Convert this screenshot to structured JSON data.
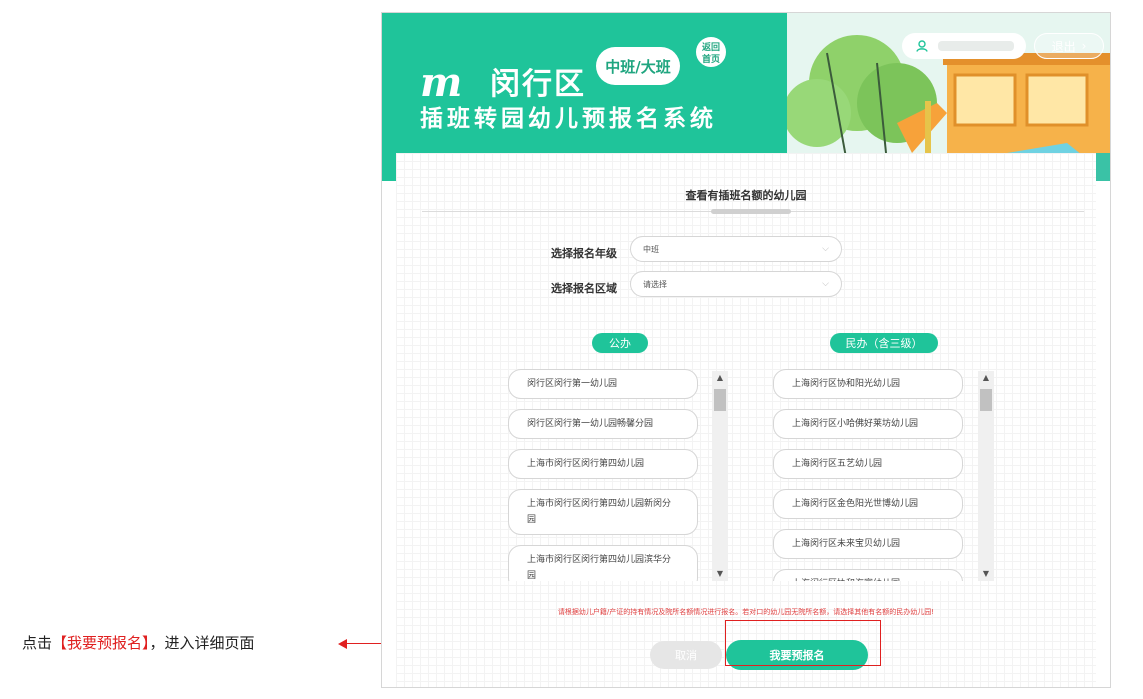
{
  "annotation": {
    "prefix": "点击",
    "highlight": "【我要预报名】",
    "suffix": "，进入详细页面"
  },
  "header": {
    "logo_mark": "m",
    "district": "闵行区",
    "badge": "中班/大班",
    "home_badge_line1": "返回",
    "home_badge_line2": "首页",
    "subtitle": "插班转园幼儿预报名系统",
    "logout_label": "退出"
  },
  "panel": {
    "title": "查看有插班名额的幼儿园",
    "grade_label": "选择报名年级",
    "grade_value": "中班",
    "area_label": "选择报名区域",
    "area_value": "请选择"
  },
  "public": {
    "heading": "公办",
    "items": [
      "闵行区闵行第一幼儿园",
      "闵行区闵行第一幼儿园畅馨分园",
      "上海市闵行区闵行第四幼儿园",
      "上海市闵行区闵行第四幼儿园新闵分园",
      "上海市闵行区闵行第四幼儿园滨华分园"
    ]
  },
  "private": {
    "heading": "民办（含三级）",
    "items": [
      "上海闵行区协和阳光幼儿园",
      "上海闵行区小哈佛好莱坊幼儿园",
      "上海闵行区五艺幼儿园",
      "上海闵行区金色阳光世博幼儿园",
      "上海闵行区未来宝贝幼儿园",
      "上海闵行区协和海富幼儿园"
    ]
  },
  "notice": "请根据幼儿户籍/产证的持有情况及院所名额情况进行报名。若对口的幼儿园无院所名额，请选择其他有名额的民办幼儿园!",
  "buttons": {
    "cancel": "取消",
    "apply": "我要预报名"
  },
  "colors": {
    "brand": "#1fc49a",
    "annotation": "#e02020"
  }
}
